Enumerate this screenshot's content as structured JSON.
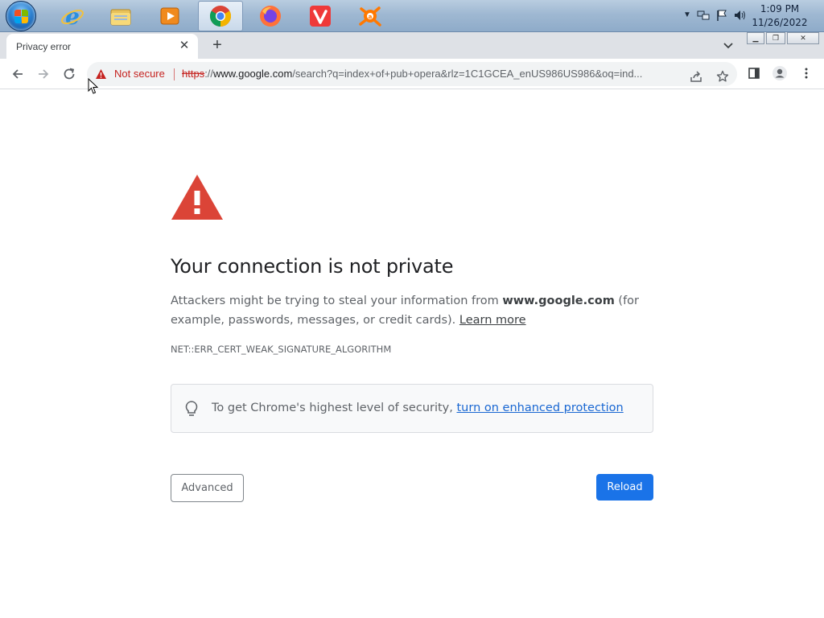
{
  "taskbar": {
    "apps": [
      {
        "name": "internet-explorer",
        "icon": "ie-icon"
      },
      {
        "name": "file-explorer",
        "icon": "folder-icon"
      },
      {
        "name": "media-player",
        "icon": "media-player-icon"
      },
      {
        "name": "chrome",
        "icon": "chrome-icon",
        "active": true
      },
      {
        "name": "firefox",
        "icon": "firefox-icon"
      },
      {
        "name": "vivaldi",
        "icon": "vivaldi-icon"
      },
      {
        "name": "avast",
        "icon": "avast-icon"
      }
    ],
    "clock": {
      "time": "1:09 PM",
      "date": "11/26/2022"
    }
  },
  "tab": {
    "title": "Privacy error",
    "close": "✕",
    "new_tab": "+"
  },
  "omnibox": {
    "security_label": "Not secure",
    "url_scheme": "https",
    "url_sep": "://",
    "url_host": "www.google.com",
    "url_rest": "/search?q=index+of+pub+opera&rlz=1C1GCEA_enUS986US986&oq=ind..."
  },
  "page": {
    "heading": "Your connection is not private",
    "para_1": "Attackers might be trying to steal your information from ",
    "para_host": "www.google.com",
    "para_2": " (for example, passwords, messages, or credit cards). ",
    "learn_more": "Learn more",
    "error_code": "NET::ERR_CERT_WEAK_SIGNATURE_ALGORITHM",
    "tip_text": "To get Chrome's highest level of security, ",
    "tip_link": "turn on enhanced protection",
    "advanced_label": "Advanced",
    "reload_label": "Reload"
  },
  "colors": {
    "accent": "#1a73e8",
    "danger": "#d93025",
    "warning_big": "#db4437"
  }
}
